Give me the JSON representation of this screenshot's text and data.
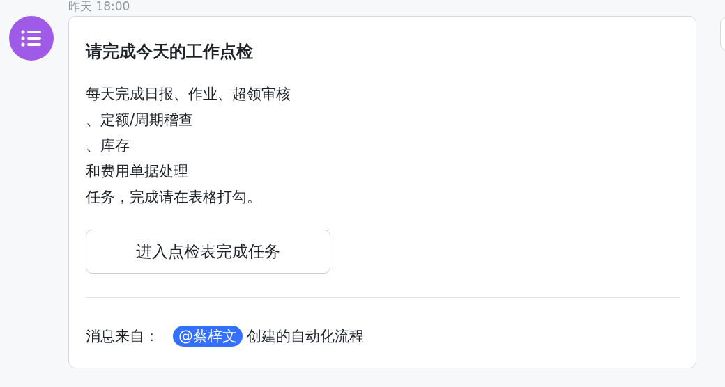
{
  "message": {
    "time": "昨天 18:00",
    "card": {
      "title": "请完成今天的工作点检",
      "body_lines": [
        "每天完成日报、作业、超领审核",
        "、定额/周期稽查",
        "、库存",
        "和费用单据处理",
        "任务，完成请在表格打勾。"
      ],
      "button": "进入点检表完成任务",
      "footer": {
        "prefix": "消息来自：",
        "mention": "@蔡梓文",
        "suffix": "创建的自动化流程"
      }
    }
  }
}
